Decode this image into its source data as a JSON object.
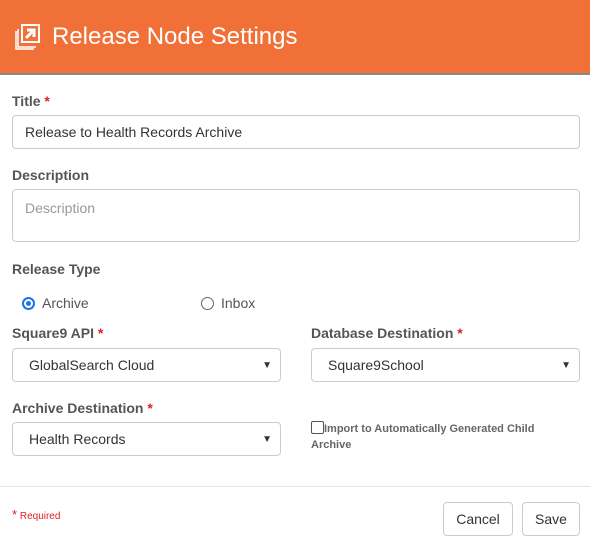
{
  "header": {
    "title": "Release Node Settings",
    "icon": "release-icon"
  },
  "form": {
    "title_label": "Title",
    "title_value": "Release to Health Records Archive",
    "description_label": "Description",
    "description_placeholder": "Description",
    "release_type_label": "Release Type",
    "release_types": [
      {
        "label": "Archive",
        "selected": true
      },
      {
        "label": "Inbox",
        "selected": false
      }
    ],
    "api_label": "Square9 API",
    "api_value": "GlobalSearch Cloud",
    "db_label": "Database Destination",
    "db_value": "Square9School",
    "archive_label": "Archive Destination",
    "archive_value": "Health Records",
    "child_archive_label": "Import to Automatically Generated Child Archive",
    "child_archive_checked": false,
    "required_mark": "*"
  },
  "footer": {
    "required_note": "Required",
    "cancel": "Cancel",
    "save": "Save"
  },
  "colors": {
    "accent": "#f07038",
    "required": "#e02020"
  }
}
